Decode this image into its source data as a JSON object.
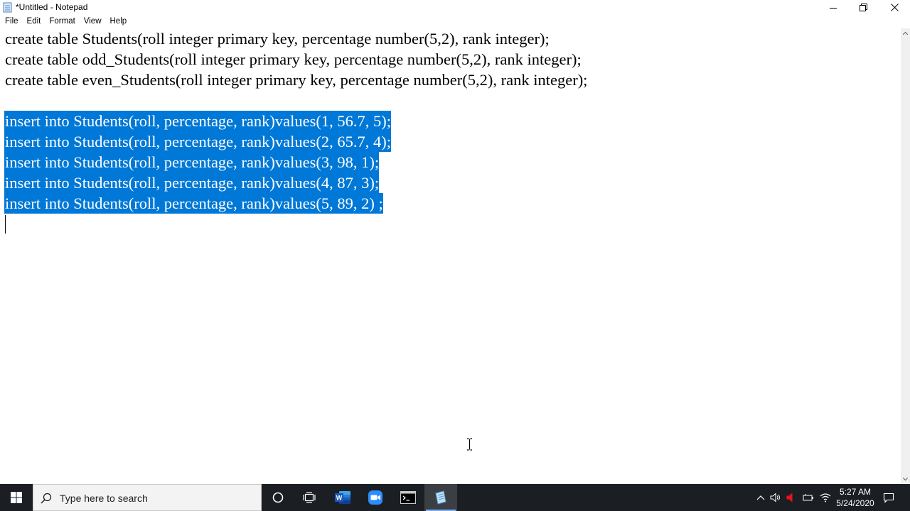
{
  "window": {
    "title": "*Untitled - Notepad"
  },
  "menu": [
    "File",
    "Edit",
    "Format",
    "View",
    "Help"
  ],
  "editor": {
    "lines": [
      "create table Students(roll integer primary key, percentage number(5,2), rank integer);",
      "create table odd_Students(roll integer primary key, percentage number(5,2), rank integer);",
      "create table even_Students(roll integer primary key, percentage number(5,2), rank integer);",
      "",
      "insert into Students(roll, percentage, rank)values(1, 56.7, 5);",
      "insert into Students(roll, percentage, rank)values(2, 65.7, 4);",
      "insert into Students(roll, percentage, rank)values(3, 98, 1);",
      "insert into Students(roll, percentage, rank)values(4, 87, 3);",
      "insert into Students(roll, percentage, rank)values(5, 89, 2) ;"
    ],
    "selection_color": "#0078d7"
  },
  "taskbar": {
    "search_placeholder": "Type here to search",
    "apps": [
      "cortana-icon",
      "task-view-icon",
      "word-icon",
      "zoom-icon",
      "terminal-icon",
      "notepad-icon"
    ],
    "clock_time": "5:27 AM",
    "clock_date": "5/24/2020"
  }
}
